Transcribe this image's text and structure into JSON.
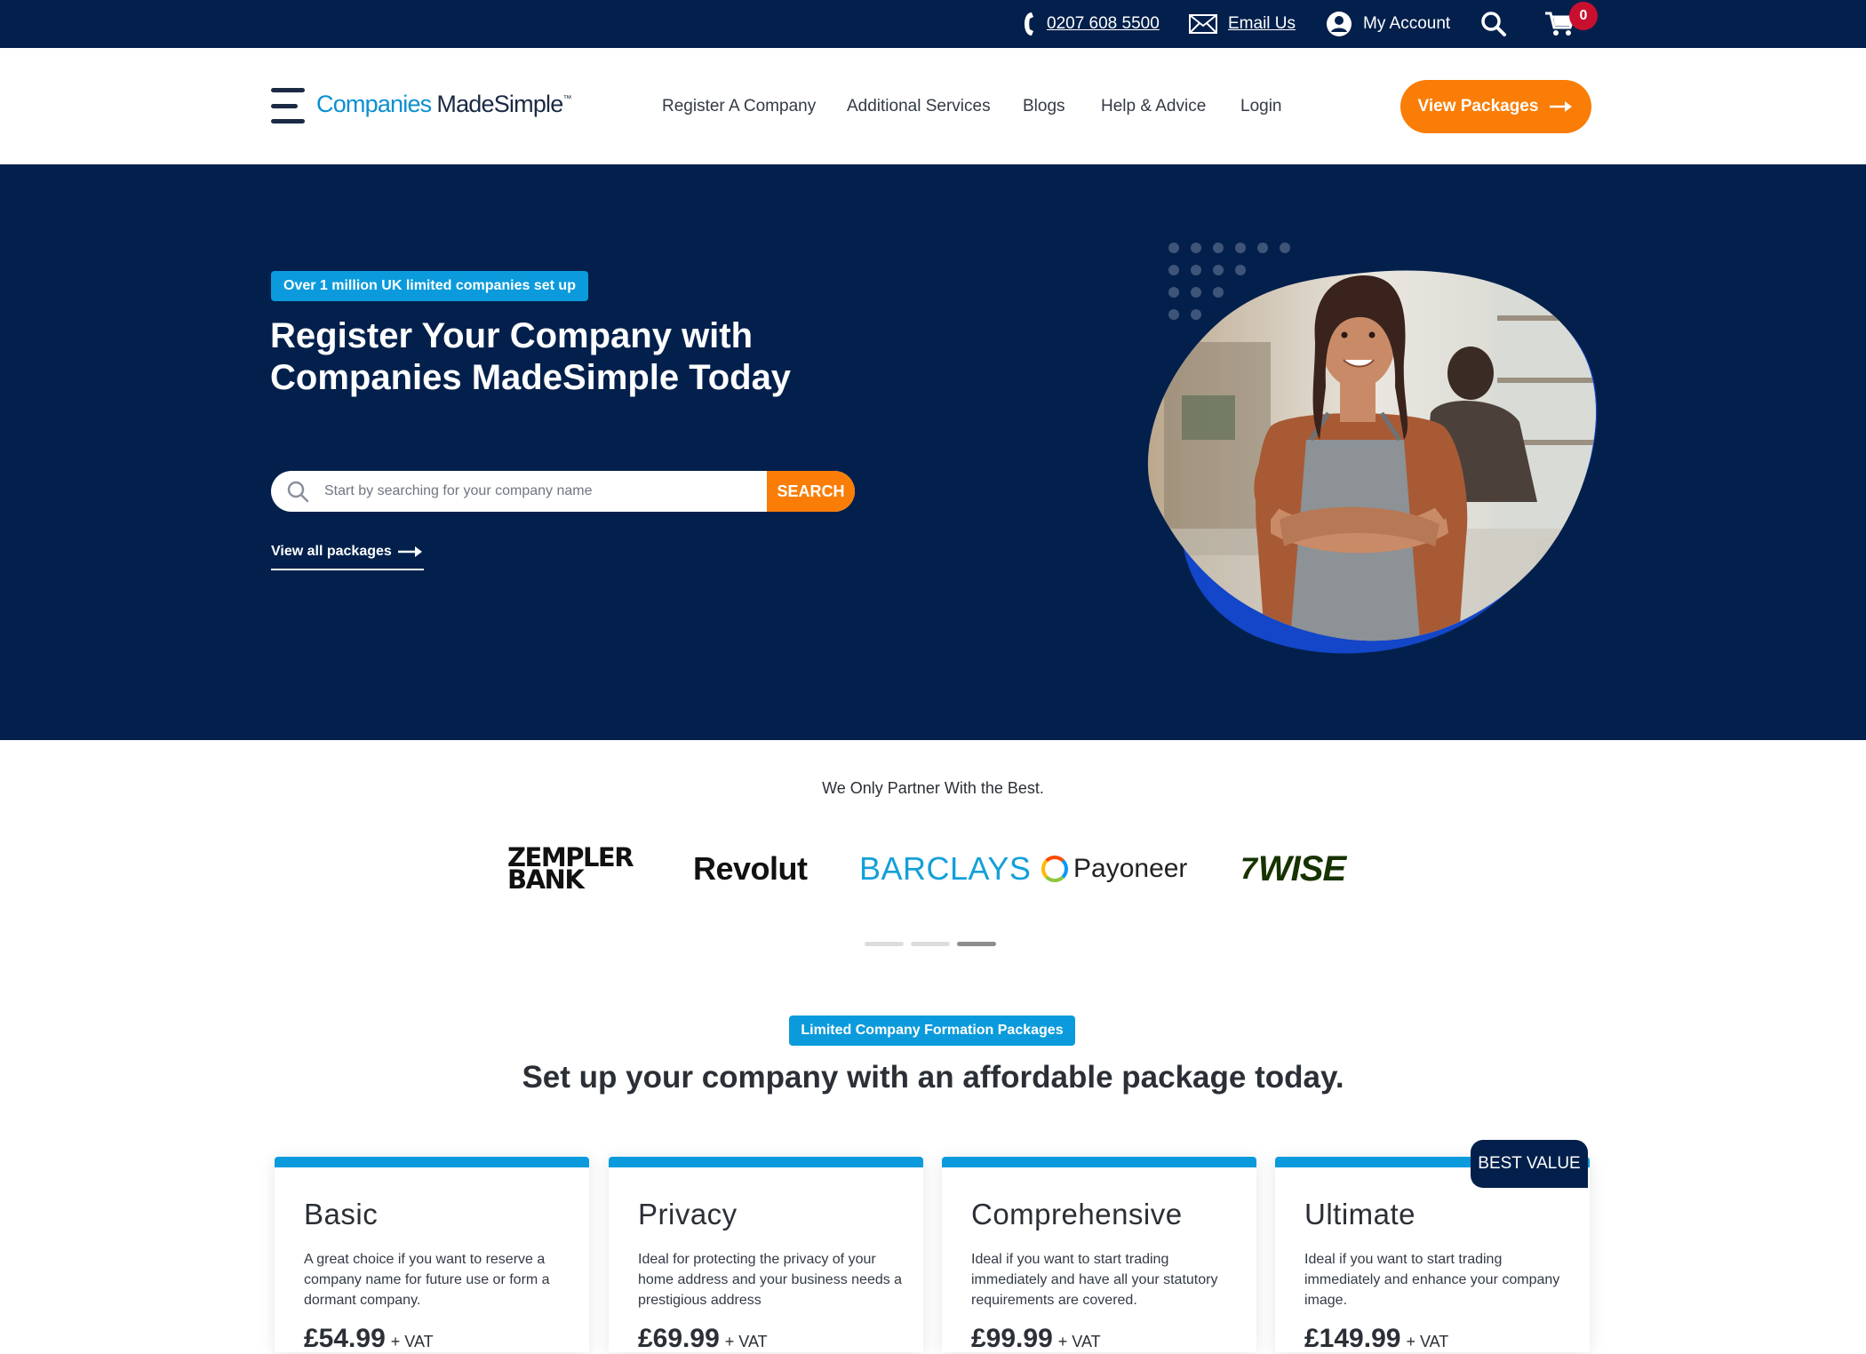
{
  "topbar": {
    "phone": "0207 608 5500",
    "email": "Email Us",
    "account": "My Account",
    "cart_count": "0"
  },
  "header": {
    "logo_part1": "Companies",
    "logo_part2": "MadeSimple",
    "logo_tm": "™",
    "menu": [
      {
        "label": "Register A Company"
      },
      {
        "label": "Additional Services"
      },
      {
        "label": "Blogs"
      },
      {
        "label": "Help & Advice"
      },
      {
        "label": "Login"
      }
    ],
    "cta": "View Packages"
  },
  "hero": {
    "tag": "Over 1 million UK limited companies set up",
    "title": "Register Your Company with Companies MadeSimple Today",
    "search_placeholder": "Start by searching for your company name",
    "search_button": "SEARCH",
    "view_all": "View all packages"
  },
  "partners": {
    "title": "We Only Partner With the Best.",
    "logos": [
      {
        "line1": "ZEMPLER",
        "line2": "BANK"
      },
      {
        "name": "Revolut"
      },
      {
        "name": "BARCLAYS"
      },
      {
        "name": "Payoneer"
      },
      {
        "name": "WISE",
        "mark": "7"
      }
    ],
    "slider": {
      "count": 3,
      "active": 3
    }
  },
  "packages": {
    "tag": "Limited Company Formation Packages",
    "title": "Set up your company with an affordable package today.",
    "badge": "BEST VALUE",
    "cards": [
      {
        "name": "Basic",
        "desc": "A great choice if you want to reserve a company name for future use or form a dormant company.",
        "price": "£54.99",
        "vat": "+ VAT"
      },
      {
        "name": "Privacy",
        "desc": "Ideal for protecting the privacy of your home address and your business needs a prestigious address",
        "price": "£69.99",
        "vat": "+ VAT"
      },
      {
        "name": "Comprehensive",
        "desc": "Ideal if you want to start trading immediately and have all your statutory requirements are covered.",
        "price": "£99.99",
        "vat": "+ VAT"
      },
      {
        "name": "Ultimate",
        "desc": "Ideal if you want to start trading immediately and enhance your company image.",
        "price": "£149.99",
        "vat": "+ VAT"
      }
    ]
  },
  "colors": {
    "navy": "#03204c",
    "orange": "#f97d06",
    "blue": "#0b9bdc",
    "royal_blue": "#1346c8"
  }
}
